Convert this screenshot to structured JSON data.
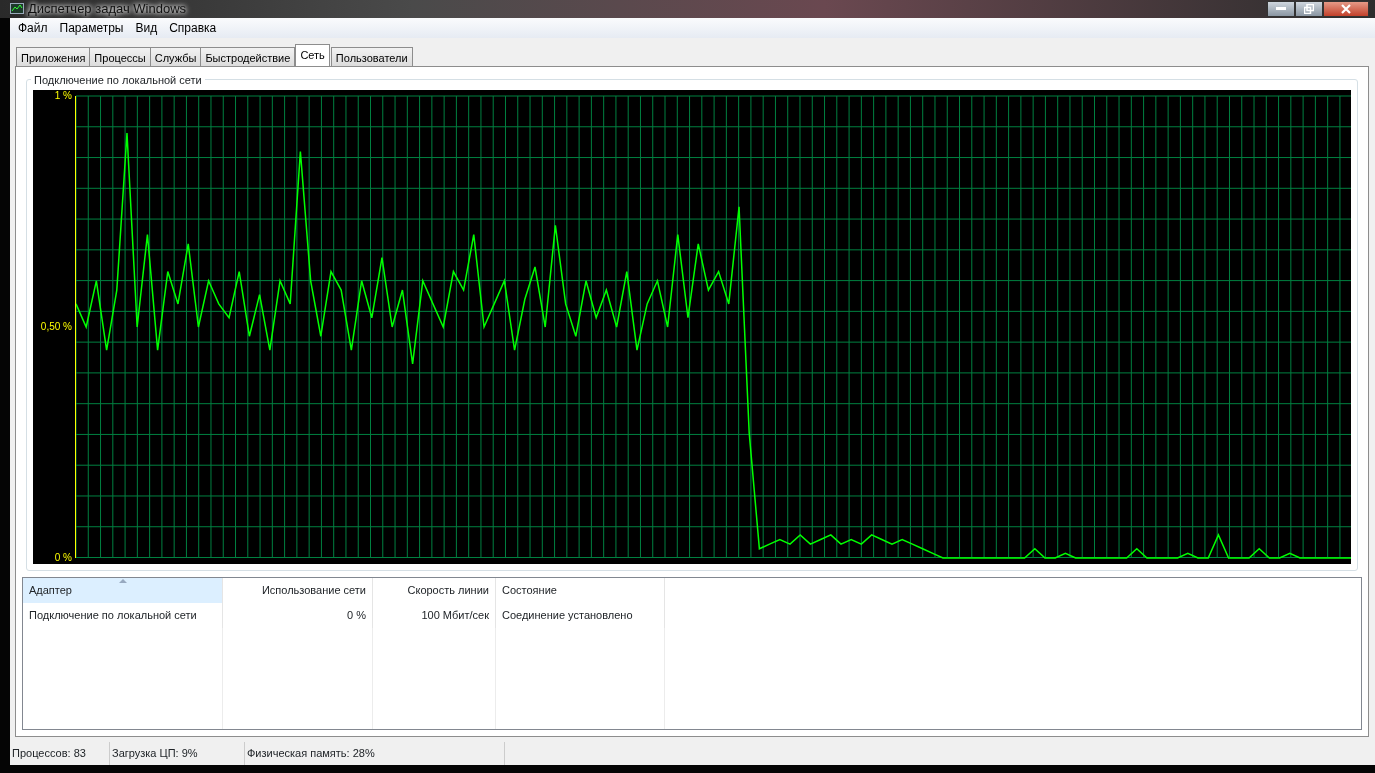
{
  "window": {
    "title": "Диспетчер задач Windows"
  },
  "menu": [
    "Файл",
    "Параметры",
    "Вид",
    "Справка"
  ],
  "tabs": [
    {
      "label": "Приложения",
      "selected": false
    },
    {
      "label": "Процессы",
      "selected": false
    },
    {
      "label": "Службы",
      "selected": false
    },
    {
      "label": "Быстродействие",
      "selected": false
    },
    {
      "label": "Сеть",
      "selected": true
    },
    {
      "label": "Пользователи",
      "selected": false
    }
  ],
  "graph": {
    "chart_data": {
      "type": "line",
      "title": "Подключение по локальной сети",
      "ylim": [
        0,
        1
      ],
      "yticks": [
        {
          "value": 0,
          "label": "0 %"
        },
        {
          "value": 0.5,
          "label": "0,50 %"
        },
        {
          "value": 1,
          "label": "1 %"
        }
      ],
      "series": [
        {
          "color": "#00ff00",
          "values": [
            0.55,
            0.5,
            0.6,
            0.45,
            0.58,
            0.92,
            0.5,
            0.7,
            0.45,
            0.62,
            0.55,
            0.68,
            0.5,
            0.6,
            0.55,
            0.52,
            0.62,
            0.48,
            0.57,
            0.45,
            0.6,
            0.55,
            0.88,
            0.6,
            0.48,
            0.62,
            0.58,
            0.45,
            0.6,
            0.52,
            0.65,
            0.5,
            0.58,
            0.42,
            0.6,
            0.55,
            0.5,
            0.62,
            0.58,
            0.7,
            0.5,
            0.55,
            0.6,
            0.45,
            0.56,
            0.63,
            0.5,
            0.72,
            0.55,
            0.48,
            0.6,
            0.52,
            0.58,
            0.5,
            0.62,
            0.45,
            0.55,
            0.6,
            0.5,
            0.7,
            0.52,
            0.68,
            0.58,
            0.62,
            0.55,
            0.76,
            0.27,
            0.02,
            0.03,
            0.04,
            0.03,
            0.05,
            0.03,
            0.04,
            0.05,
            0.03,
            0.04,
            0.03,
            0.05,
            0.04,
            0.03,
            0.04,
            0.03,
            0.02,
            0.01,
            0.0,
            0.0,
            0.0,
            0.0,
            0.0,
            0.0,
            0.0,
            0.0,
            0.0,
            0.02,
            0.0,
            0.0,
            0.01,
            0.0,
            0.0,
            0.0,
            0.0,
            0.0,
            0.0,
            0.02,
            0.0,
            0.0,
            0.0,
            0.0,
            0.01,
            0.0,
            0.0,
            0.05,
            0.0,
            0.0,
            0.0,
            0.02,
            0.0,
            0.0,
            0.01,
            0.0,
            0.0,
            0.0,
            0.0,
            0.0,
            0.0
          ]
        }
      ]
    }
  },
  "table": {
    "columns": [
      {
        "label": "Адаптер",
        "sorted": true
      },
      {
        "label": "Использование сети",
        "sorted": false
      },
      {
        "label": "Скорость линии",
        "sorted": false
      },
      {
        "label": "Состояние",
        "sorted": false
      }
    ],
    "rows": [
      [
        "Подключение по локальной сети",
        "0 %",
        "100 Мбит/сек",
        "Соединение установлено"
      ]
    ]
  },
  "status_bar": [
    "Процессов: 83",
    "Загрузка ЦП: 9%",
    "Физическая память: 28%"
  ]
}
